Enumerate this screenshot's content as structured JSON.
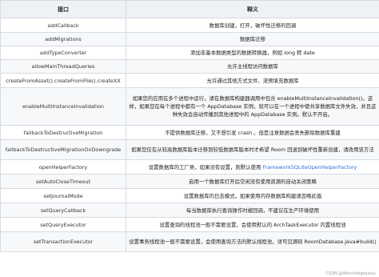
{
  "table": {
    "headers": [
      "接口",
      "释义"
    ],
    "rows": [
      {
        "name": "addCallback",
        "desc": "数据库创建，打开，破坏性迁移的回调"
      },
      {
        "name": "addMigrations",
        "desc": "数据库迁移"
      },
      {
        "name": "addTypeConverter",
        "desc": "添加非基本数据类型的数据转换器，例如 long 转 date"
      },
      {
        "name": "allowMainThreadQueries",
        "desc": "允许主线程访问数据库"
      },
      {
        "name": "createFromAsset().createFromFile().createXX",
        "desc": "允许通过其他方式文件、流预填充数据库"
      },
      {
        "name": "enableMultiInstanceInvalidation",
        "desc": "如果您的应用在多个进程中运行，请在数据库构建器调用中包含 enableMultiInstanceInvalidation()。这样，如果您在每个进程中都有一个 AppDatabase 实例，就可以在一个进程中使共享数据库文件失效，并且这种失效会自动传播到其他进程中的 AppDatabase 实例。默认不开启。"
      },
      {
        "name": "fallbackToDestructiveMigration",
        "desc": "不提供数据库迁移，又不想引发 crash 。但是注意数据会丢失删除数据库重建"
      },
      {
        "name": "fallbackToDestructiveMigrationOnDowngrade",
        "desc": "如果您仅在从较高数据库版本迁移到较低数据库版本时才希望 Room 回退到破坏性重新创建，请改用该方法"
      },
      {
        "name": "openHelperFactory",
        "desc": "设置数据库的工厂类，如果没有设置，则默认使用",
        "desc_link": "FrameworkSQLiteOpenHelperFactory"
      },
      {
        "name": "setAutoCloseTimeout",
        "desc": "启用一个数据库打开后空闲没有使用资源的自动关闭策略"
      },
      {
        "name": "setJournalMode",
        "desc": "设置数据库的日志模式，如果使用内存数据库构建请忽略此值"
      },
      {
        "name": "setQueryCallback",
        "desc": "每当数据库执行查询操作时被回调，不建议在生产环境使用"
      },
      {
        "name": "setQueryExecutor",
        "desc": "设置查询的线程池一般不需要设置，会使用默认的 ArchTaskExecutor 内置线程池"
      },
      {
        "name": "setTransactionExecutor",
        "desc": "设置事务线程池一般不需要设置，会使用查询方法的默认线程池，详可见源码 RoomDatabase.java#build()"
      }
    ]
  },
  "watermark": "CSDN @Wotchdogbalaxy"
}
